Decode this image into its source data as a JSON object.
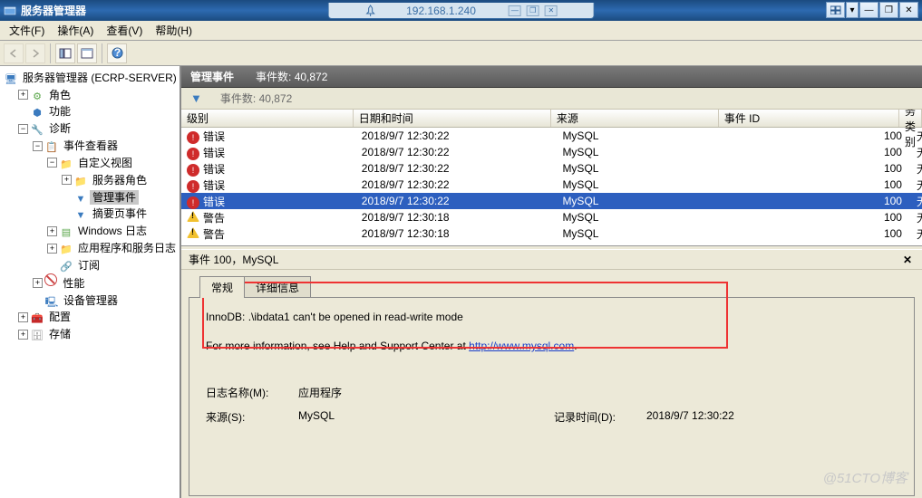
{
  "window": {
    "title": "服务器管理器",
    "remote_ip": "192.168.1.240"
  },
  "menu": {
    "file": "文件(F)",
    "action": "操作(A)",
    "view": "查看(V)",
    "help": "帮助(H)"
  },
  "tree": {
    "root": "服务器管理器 (ECRP-SERVER)",
    "roles": "角色",
    "features": "功能",
    "diag": "诊断",
    "event_viewer": "事件查看器",
    "custom_views": "自定义视图",
    "server_roles": "服务器角色",
    "admin_events": "管理事件",
    "summary_events": "摘要页事件",
    "windows_logs": "Windows 日志",
    "app_service_logs": "应用程序和服务日志",
    "subscriptions": "订阅",
    "perf": "性能",
    "devmgr": "设备管理器",
    "config": "配置",
    "storage": "存储"
  },
  "header": {
    "title": "管理事件",
    "count_label": "事件数:",
    "count_value": "40,872"
  },
  "filter": {
    "count_label": "事件数:",
    "count_value": "40,872"
  },
  "grid": {
    "columns": {
      "level": "级别",
      "datetime": "日期和时间",
      "source": "来源",
      "event_id": "事件 ID",
      "task": "任务类别"
    },
    "rows": [
      {
        "level": "错误",
        "lvl": "err",
        "datetime": "2018/9/7 12:30:22",
        "source": "MySQL",
        "event_id": "100",
        "task": "无",
        "sel": false
      },
      {
        "level": "错误",
        "lvl": "err",
        "datetime": "2018/9/7 12:30:22",
        "source": "MySQL",
        "event_id": "100",
        "task": "无",
        "sel": false
      },
      {
        "level": "错误",
        "lvl": "err",
        "datetime": "2018/9/7 12:30:22",
        "source": "MySQL",
        "event_id": "100",
        "task": "无",
        "sel": false
      },
      {
        "level": "错误",
        "lvl": "err",
        "datetime": "2018/9/7 12:30:22",
        "source": "MySQL",
        "event_id": "100",
        "task": "无",
        "sel": false
      },
      {
        "level": "错误",
        "lvl": "err",
        "datetime": "2018/9/7 12:30:22",
        "source": "MySQL",
        "event_id": "100",
        "task": "无",
        "sel": true
      },
      {
        "level": "警告",
        "lvl": "warn",
        "datetime": "2018/9/7 12:30:18",
        "source": "MySQL",
        "event_id": "100",
        "task": "无",
        "sel": false
      },
      {
        "level": "警告",
        "lvl": "warn",
        "datetime": "2018/9/7 12:30:18",
        "source": "MySQL",
        "event_id": "100",
        "task": "无",
        "sel": false
      }
    ]
  },
  "detail": {
    "title": "事件 100，MySQL",
    "tabs": {
      "general": "常规",
      "details": "详细信息"
    },
    "message": "InnoDB: .\\ibdata1 can't be opened in read-write mode",
    "more_info_prefix": "For more information, see Help and Support Center at ",
    "more_info_link": "http://www.mysql.com",
    "log_name_label": "日志名称(M):",
    "log_name_value": "应用程序",
    "source_label": "来源(S):",
    "source_value": "MySQL",
    "logged_label": "记录时间(D):",
    "logged_value": "2018/9/7 12:30:22"
  },
  "watermark": "@51CTO博客",
  "toggle": {
    "plus": "+",
    "minus": "−"
  }
}
